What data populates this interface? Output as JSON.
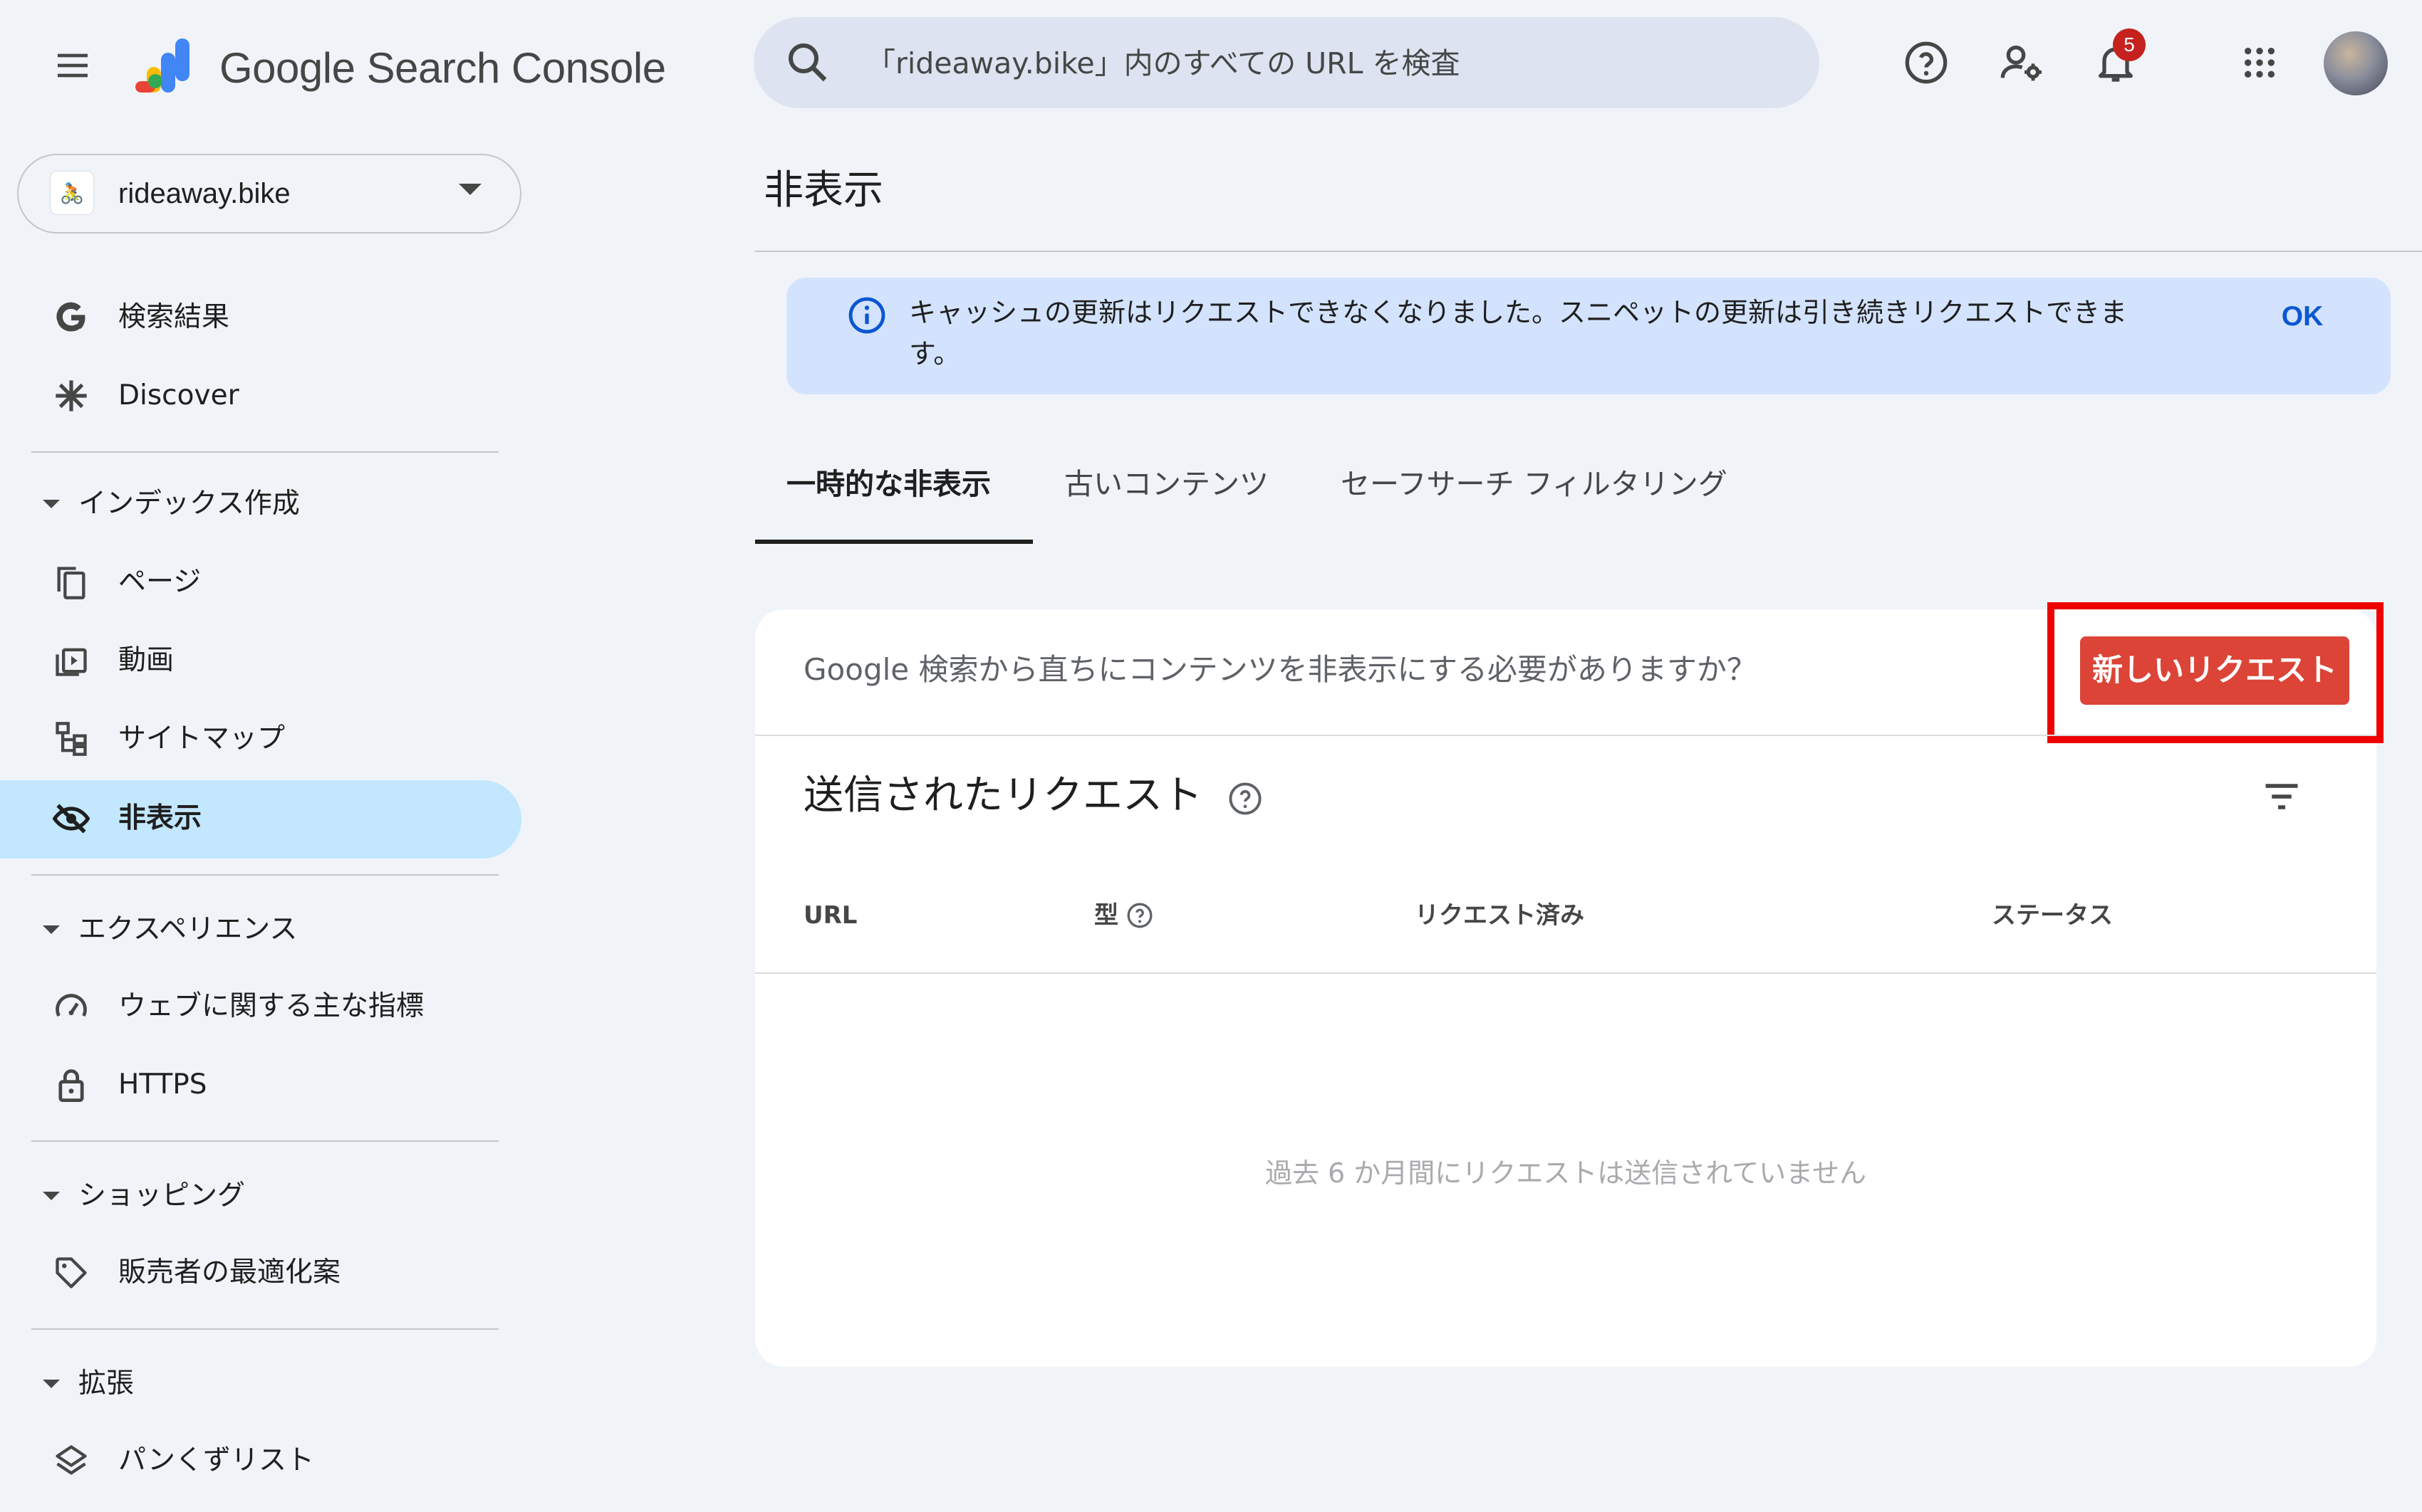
{
  "header": {
    "product_name": "Google Search Console",
    "search_placeholder": "「rideaway.bike」内のすべての URL を検査",
    "notification_count": "5",
    "icons": [
      "menu-icon",
      "search-console-logo",
      "search-icon",
      "help-icon",
      "users-settings-icon",
      "bell-icon",
      "apps-grid-icon",
      "avatar"
    ]
  },
  "property": {
    "name": "rideaway.bike",
    "favicon": "🚴"
  },
  "sidebar": {
    "top_items": [
      {
        "label": "検索結果",
        "icon": "google-g-icon"
      },
      {
        "label": "Discover",
        "icon": "asterisk-icon"
      }
    ],
    "sections": [
      {
        "title": "インデックス作成",
        "items": [
          {
            "label": "ページ",
            "icon": "pages-icon"
          },
          {
            "label": "動画",
            "icon": "video-icon"
          },
          {
            "label": "サイトマップ",
            "icon": "sitemap-icon"
          },
          {
            "label": "非表示",
            "icon": "eye-off-icon",
            "active": true
          }
        ]
      },
      {
        "title": "エクスペリエンス",
        "items": [
          {
            "label": "ウェブに関する主な指標",
            "icon": "gauge-icon"
          },
          {
            "label": "HTTPS",
            "icon": "lock-icon"
          }
        ]
      },
      {
        "title": "ショッピング",
        "items": [
          {
            "label": "販売者の最適化案",
            "icon": "tag-icon"
          }
        ]
      },
      {
        "title": "拡張",
        "items": [
          {
            "label": "パンくずリスト",
            "icon": "layers-icon"
          }
        ]
      }
    ]
  },
  "main": {
    "page_title": "非表示",
    "banner": {
      "text": "キャッシュの更新はリクエストできなくなりました。スニペットの更新は引き続きリクエストできます。",
      "ok_label": "OK"
    },
    "tabs": [
      {
        "label": "一時的な非表示",
        "active": true
      },
      {
        "label": "古いコンテンツ"
      },
      {
        "label": "セーフサーチ フィルタリング"
      }
    ],
    "card": {
      "question": "Google 検索から直ちにコンテンツを非表示にする必要がありますか？",
      "new_request_label": "新しいリクエスト",
      "submitted_title": "送信されたリクエスト",
      "columns": [
        "URL",
        "型",
        "リクエスト済み",
        "ステータス"
      ],
      "empty_message": "過去 6 か月間にリクエストは送信されていません"
    }
  },
  "colors": {
    "background": "#f0f4f9",
    "active_nav": "#c2e7ff",
    "banner": "#d3e3fd",
    "primary_button": "#db4437",
    "highlight": "#ee0000",
    "link": "#0b57d0"
  }
}
